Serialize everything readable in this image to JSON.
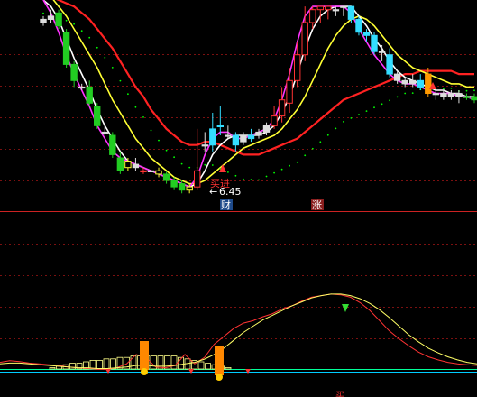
{
  "chart_data": [
    {
      "type": "candlestick",
      "panel": "price",
      "annotations": {
        "low_price": "6.45",
        "low_marker": "←",
        "badge_finance": "财",
        "badge_rise": "涨",
        "buy_signal": "买进",
        "signal_text": "买"
      },
      "colors": {
        "up": "#ff3333",
        "down_cyan": "#33ddff",
        "down_green": "#22cc22",
        "ma_white": "#ffffff",
        "ma_yellow": "#ffff33",
        "ma_magenta": "#ff33ff",
        "ma_red": "#ff2222",
        "ma_dotted": "#00ff00"
      },
      "candles": [
        {
          "o": 6.98,
          "c": 6.99,
          "h": 7.0,
          "l": 6.97,
          "col": "flat"
        },
        {
          "o": 7.0,
          "c": 6.99,
          "h": 7.02,
          "l": 6.98,
          "col": "flat"
        },
        {
          "o": 7.01,
          "c": 6.97,
          "h": 7.02,
          "l": 6.96,
          "col": "green"
        },
        {
          "o": 6.95,
          "c": 6.85,
          "h": 6.96,
          "l": 6.84,
          "col": "green"
        },
        {
          "o": 6.85,
          "c": 6.8,
          "h": 6.86,
          "l": 6.78,
          "col": "green"
        },
        {
          "o": 6.78,
          "c": 6.78,
          "h": 6.79,
          "l": 6.77,
          "col": "flat"
        },
        {
          "o": 6.78,
          "c": 6.73,
          "h": 6.8,
          "l": 6.72,
          "col": "green"
        },
        {
          "o": 6.72,
          "c": 6.66,
          "h": 6.73,
          "l": 6.65,
          "col": "green"
        },
        {
          "o": 6.64,
          "c": 6.64,
          "h": 6.66,
          "l": 6.63,
          "col": "flat"
        },
        {
          "o": 6.63,
          "c": 6.57,
          "h": 6.64,
          "l": 6.56,
          "col": "green"
        },
        {
          "o": 6.56,
          "c": 6.52,
          "h": 6.58,
          "l": 6.51,
          "col": "green"
        },
        {
          "o": 6.53,
          "c": 6.55,
          "h": 6.56,
          "l": 6.52,
          "col": "yellow"
        },
        {
          "o": 6.54,
          "c": 6.53,
          "h": 6.56,
          "l": 6.52,
          "col": "flat"
        },
        {
          "o": 6.52,
          "c": 6.52,
          "h": 6.53,
          "l": 6.51,
          "col": "red"
        },
        {
          "o": 6.52,
          "c": 6.52,
          "h": 6.53,
          "l": 6.51,
          "col": "flat"
        },
        {
          "o": 6.51,
          "c": 6.52,
          "h": 6.53,
          "l": 6.5,
          "col": "yellow"
        },
        {
          "o": 6.51,
          "c": 6.49,
          "h": 6.52,
          "l": 6.48,
          "col": "green"
        },
        {
          "o": 6.49,
          "c": 6.47,
          "h": 6.5,
          "l": 6.46,
          "col": "green"
        },
        {
          "o": 6.48,
          "c": 6.46,
          "h": 6.49,
          "l": 6.45,
          "col": "green"
        },
        {
          "o": 6.46,
          "c": 6.47,
          "h": 6.48,
          "l": 6.45,
          "col": "yellow"
        },
        {
          "o": 6.47,
          "c": 6.52,
          "h": 6.65,
          "l": 6.46,
          "col": "red"
        },
        {
          "o": 6.6,
          "c": 6.6,
          "h": 6.64,
          "l": 6.58,
          "col": "flat"
        },
        {
          "o": 6.6,
          "c": 6.65,
          "h": 6.7,
          "l": 6.58,
          "col": "cyan"
        },
        {
          "o": 6.66,
          "c": 6.66,
          "h": 6.72,
          "l": 6.63,
          "col": "cyan"
        },
        {
          "o": 6.63,
          "c": 6.63,
          "h": 6.66,
          "l": 6.62,
          "col": "flat"
        },
        {
          "o": 6.63,
          "c": 6.6,
          "h": 6.64,
          "l": 6.58,
          "col": "cyan"
        },
        {
          "o": 6.61,
          "c": 6.63,
          "h": 6.64,
          "l": 6.6,
          "col": "flat"
        },
        {
          "o": 6.62,
          "c": 6.63,
          "h": 6.65,
          "l": 6.61,
          "col": "cyan"
        },
        {
          "o": 6.63,
          "c": 6.64,
          "h": 6.65,
          "l": 6.62,
          "col": "flat"
        },
        {
          "o": 6.64,
          "c": 6.66,
          "h": 6.67,
          "l": 6.63,
          "col": "flat"
        },
        {
          "o": 6.66,
          "c": 6.69,
          "h": 6.72,
          "l": 6.65,
          "col": "red"
        },
        {
          "o": 6.69,
          "c": 6.74,
          "h": 6.78,
          "l": 6.67,
          "col": "red"
        },
        {
          "o": 6.73,
          "c": 6.8,
          "h": 6.84,
          "l": 6.7,
          "col": "red"
        },
        {
          "o": 6.8,
          "c": 6.88,
          "h": 6.92,
          "l": 6.78,
          "col": "red"
        },
        {
          "o": 6.88,
          "c": 6.98,
          "h": 7.03,
          "l": 6.86,
          "col": "red"
        },
        {
          "o": 6.98,
          "c": 7.02,
          "h": 7.03,
          "l": 6.96,
          "col": "red"
        },
        {
          "o": 7.02,
          "c": 7.03,
          "h": 7.03,
          "l": 6.98,
          "col": "red"
        },
        {
          "o": 7.02,
          "c": 7.03,
          "h": 7.03,
          "l": 6.99,
          "col": "red"
        },
        {
          "o": 7.02,
          "c": 7.02,
          "h": 7.03,
          "l": 7.0,
          "col": "flat"
        },
        {
          "o": 7.03,
          "c": 7.03,
          "h": 7.03,
          "l": 7.0,
          "col": "flat"
        },
        {
          "o": 7.03,
          "c": 6.99,
          "h": 7.03,
          "l": 6.98,
          "col": "cyan"
        },
        {
          "o": 6.99,
          "c": 6.95,
          "h": 7.0,
          "l": 6.94,
          "col": "cyan"
        },
        {
          "o": 6.95,
          "c": 6.94,
          "h": 6.96,
          "l": 6.92,
          "col": "cyan"
        },
        {
          "o": 6.94,
          "c": 6.89,
          "h": 6.95,
          "l": 6.88,
          "col": "cyan"
        },
        {
          "o": 6.89,
          "c": 6.89,
          "h": 6.91,
          "l": 6.86,
          "col": "flat"
        },
        {
          "o": 6.88,
          "c": 6.82,
          "h": 6.9,
          "l": 6.81,
          "col": "cyan"
        },
        {
          "o": 6.82,
          "c": 6.8,
          "h": 6.83,
          "l": 6.79,
          "col": "flat"
        },
        {
          "o": 6.8,
          "c": 6.79,
          "h": 6.81,
          "l": 6.78,
          "col": "flat"
        },
        {
          "o": 6.79,
          "c": 6.8,
          "h": 6.82,
          "l": 6.78,
          "col": "flat"
        },
        {
          "o": 6.8,
          "c": 6.78,
          "h": 6.82,
          "l": 6.77,
          "col": "cyan"
        },
        {
          "o": 6.82,
          "c": 6.76,
          "h": 6.84,
          "l": 6.75,
          "col": "orange"
        },
        {
          "o": 6.76,
          "c": 6.76,
          "h": 6.77,
          "l": 6.74,
          "col": "flat"
        },
        {
          "o": 6.76,
          "c": 6.75,
          "h": 6.77,
          "l": 6.74,
          "col": "flat"
        },
        {
          "o": 6.75,
          "c": 6.76,
          "h": 6.77,
          "l": 6.74,
          "col": "flat"
        },
        {
          "o": 6.76,
          "c": 6.75,
          "h": 6.77,
          "l": 6.73,
          "col": "flat"
        },
        {
          "o": 6.75,
          "c": 6.75,
          "h": 6.76,
          "l": 6.74,
          "col": "green"
        },
        {
          "o": 6.75,
          "c": 6.74,
          "h": 6.76,
          "l": 6.73,
          "col": "green"
        }
      ],
      "ma_white": [
        7.05,
        7.03,
        6.99,
        6.93,
        6.87,
        6.82,
        6.77,
        6.71,
        6.66,
        6.62,
        6.58,
        6.55,
        6.54,
        6.53,
        6.52,
        6.51,
        6.5,
        6.49,
        6.48,
        6.47,
        6.48,
        6.52,
        6.57,
        6.6,
        6.62,
        6.63,
        6.63,
        6.63,
        6.63,
        6.64,
        6.66,
        6.7,
        6.75,
        6.82,
        6.9,
        6.96,
        7.0,
        7.02,
        7.03,
        7.03,
        7.03,
        7.0,
        6.97,
        6.93,
        6.9,
        6.86,
        6.83,
        6.81,
        6.8,
        6.79,
        6.78,
        6.77,
        6.77,
        6.76,
        6.76,
        6.75,
        6.75
      ],
      "ma_magenta": [
        7.05,
        7.01,
        6.95,
        6.88,
        6.82,
        6.77,
        6.72,
        6.66,
        6.62,
        6.58,
        6.56,
        6.55,
        6.54,
        6.53,
        6.52,
        6.51,
        6.5,
        6.49,
        6.48,
        6.47,
        6.5,
        6.57,
        6.62,
        6.64,
        6.64,
        6.62,
        6.62,
        6.63,
        6.64,
        6.65,
        6.68,
        6.74,
        6.82,
        6.92,
        7.0,
        7.03,
        7.03,
        7.03,
        7.03,
        7.03,
        7.01,
        6.96,
        6.92,
        6.88,
        6.85,
        6.82,
        6.8,
        6.79,
        6.79,
        6.78,
        6.77,
        6.76,
        6.76,
        6.76,
        6.75,
        6.75,
        6.74
      ],
      "ma_yellow": [
        7.08,
        7.06,
        7.03,
        7.0,
        6.96,
        6.92,
        6.88,
        6.84,
        6.79,
        6.74,
        6.7,
        6.66,
        6.62,
        6.59,
        6.56,
        6.54,
        6.52,
        6.5,
        6.49,
        6.48,
        6.48,
        6.49,
        6.51,
        6.53,
        6.55,
        6.57,
        6.59,
        6.6,
        6.61,
        6.62,
        6.63,
        6.65,
        6.68,
        6.71,
        6.75,
        6.8,
        6.85,
        6.9,
        6.94,
        6.97,
        6.99,
        7.0,
        6.99,
        6.97,
        6.94,
        6.91,
        6.88,
        6.86,
        6.84,
        6.83,
        6.82,
        6.81,
        6.8,
        6.79,
        6.79,
        6.78,
        6.78
      ],
      "ma_red": [
        7.06,
        7.06,
        7.05,
        7.04,
        7.03,
        7.01,
        6.99,
        6.96,
        6.93,
        6.9,
        6.86,
        6.82,
        6.78,
        6.75,
        6.71,
        6.68,
        6.65,
        6.63,
        6.61,
        6.6,
        6.6,
        6.61,
        6.61,
        6.6,
        6.59,
        6.58,
        6.57,
        6.57,
        6.57,
        6.58,
        6.59,
        6.6,
        6.61,
        6.62,
        6.64,
        6.66,
        6.68,
        6.7,
        6.72,
        6.74,
        6.75,
        6.76,
        6.77,
        6.78,
        6.79,
        6.8,
        6.81,
        6.82,
        6.82,
        6.83,
        6.83,
        6.83,
        6.83,
        6.83,
        6.82,
        6.82,
        6.82
      ]
    },
    {
      "type": "line",
      "panel": "indicator",
      "colors": {
        "line_a": "#ff3333",
        "line_b": "#ffff66",
        "line_c": "#00ff99",
        "line_d": "#00ccff",
        "bars": "#ffff88",
        "flame": "#ff8800"
      },
      "series": [
        {
          "values": [
            0.12,
            0.14,
            0.13,
            0.11,
            0.1,
            0.09,
            0.08,
            0.06,
            0.05,
            0.04,
            0.03,
            0.03,
            0.05,
            0.1,
            0.22,
            0.18,
            0.06,
            0.05,
            0.08,
            0.22,
            0.1,
            0.18,
            0.35,
            0.45,
            0.55,
            0.62,
            0.65,
            0.7,
            0.74,
            0.8,
            0.84,
            0.9,
            0.95,
            0.97,
            0.99,
            0.98,
            0.95,
            0.88,
            0.78,
            0.65,
            0.52,
            0.42,
            0.33,
            0.25,
            0.19,
            0.15,
            0.12,
            0.1,
            0.09,
            0.08
          ]
        },
        {
          "values": [
            0.1,
            0.11,
            0.11,
            0.1,
            0.09,
            0.08,
            0.07,
            0.06,
            0.05,
            0.05,
            0.04,
            0.04,
            0.05,
            0.06,
            0.08,
            0.08,
            0.07,
            0.07,
            0.08,
            0.1,
            0.12,
            0.16,
            0.22,
            0.3,
            0.4,
            0.5,
            0.58,
            0.66,
            0.72,
            0.78,
            0.84,
            0.89,
            0.94,
            0.97,
            0.99,
            0.99,
            0.97,
            0.93,
            0.87,
            0.79,
            0.69,
            0.58,
            0.47,
            0.38,
            0.3,
            0.24,
            0.19,
            0.15,
            0.12,
            0.1
          ]
        },
        {
          "values": [
            0.06,
            0.06,
            0.06,
            0.06,
            0.06,
            0.06,
            0.06,
            0.06,
            0.06,
            0.06,
            0.06,
            0.06,
            0.06,
            0.06,
            0.06,
            0.06,
            0.06,
            0.06,
            0.06,
            0.06,
            0.06,
            0.06,
            0.06,
            0.06,
            0.06,
            0.06,
            0.06,
            0.06,
            0.06,
            0.06,
            0.06,
            0.06,
            0.06,
            0.06,
            0.06,
            0.06,
            0.06,
            0.06,
            0.06,
            0.06,
            0.06,
            0.06,
            0.06,
            0.06,
            0.06,
            0.06,
            0.06,
            0.06,
            0.06,
            0.06
          ]
        }
      ],
      "bars": [
        0,
        0,
        1,
        2,
        3,
        4,
        4,
        5,
        6,
        6,
        7,
        7,
        8,
        8,
        9,
        9,
        9,
        9,
        9,
        9,
        9,
        8,
        7,
        6,
        5,
        4,
        3,
        2,
        1,
        0
      ]
    }
  ]
}
